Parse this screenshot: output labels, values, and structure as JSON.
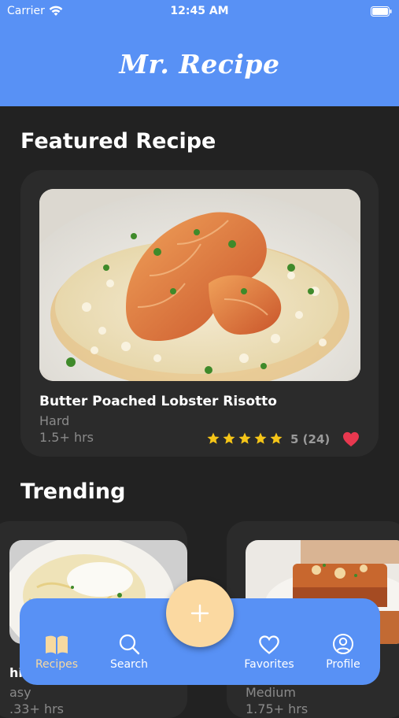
{
  "status_bar": {
    "carrier": "Carrier",
    "time": "12:45 AM"
  },
  "app": {
    "title": "Mr. Recipe"
  },
  "featured": {
    "section_title": "Featured Recipe",
    "name": "Butter Poached Lobster Risotto",
    "difficulty": "Hard",
    "time": "1.5+ hrs",
    "rating_text": "5 (24)",
    "stars": 5,
    "favorited": true
  },
  "trending": {
    "section_title": "Trending",
    "cards": [
      {
        "name_partial": "hi",
        "difficulty_partial": "asy",
        "time_partial": ".33+ hrs"
      },
      {
        "difficulty": "Medium",
        "time": "1.75+ hrs"
      }
    ]
  },
  "tabbar": {
    "items": [
      {
        "label": "Recipes",
        "icon": "book-icon"
      },
      {
        "label": "Search",
        "icon": "search-icon"
      },
      {
        "label": "Favorites",
        "icon": "heart-outline-icon"
      },
      {
        "label": "Profile",
        "icon": "profile-icon"
      }
    ],
    "fab_icon": "plus-icon"
  },
  "colors": {
    "header": "#5891f5",
    "background": "#222222",
    "card": "#2b2b2b",
    "accent": "#fbd9a1",
    "star": "#f5c518",
    "heart": "#e8384f"
  }
}
